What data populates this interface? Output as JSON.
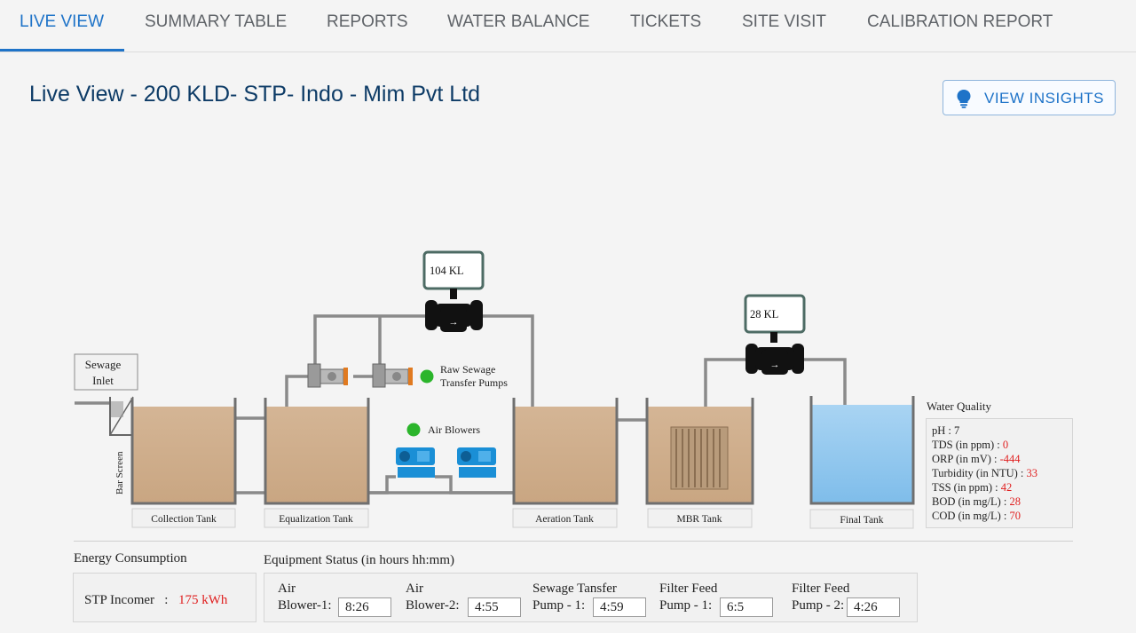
{
  "tabs": [
    {
      "label": "LIVE VIEW",
      "active": true
    },
    {
      "label": "SUMMARY TABLE"
    },
    {
      "label": "REPORTS"
    },
    {
      "label": "WATER BALANCE"
    },
    {
      "label": "TICKETS"
    },
    {
      "label": "SITE VISIT"
    },
    {
      "label": "CALIBRATION REPORT"
    }
  ],
  "page_title": "Live View - 200 KLD- STP- Indo - Mim Pvt Ltd",
  "insights_button": {
    "label": "VIEW INSIGHTS",
    "icon": "lightbulb-icon"
  },
  "diagram": {
    "sewage_inlet": [
      "Sewage",
      "Inlet"
    ],
    "bar_screen": "Bar Screen",
    "flowmeter_1": "104 KL",
    "flowmeter_2": "28 KL",
    "raw_pumps_label": [
      "Raw Sewage",
      "Transfer Pumps"
    ],
    "air_blowers_label": "Air Blowers",
    "tanks": {
      "collection": "Collection Tank",
      "equalization": "Equalization Tank",
      "aeration": "Aeration Tank",
      "mbr": "MBR Tank",
      "final": "Final Tank"
    },
    "status_color": "#2bb52b"
  },
  "water_quality": {
    "title": "Water Quality",
    "rows": [
      {
        "label": "pH :",
        "value": "7",
        "red": false
      },
      {
        "label": "TDS (in ppm) :",
        "value": "0",
        "red": true
      },
      {
        "label": "ORP (in mV) :",
        "value": "-444",
        "red": true
      },
      {
        "label": "Turbidity (in NTU) :",
        "value": "33",
        "red": true
      },
      {
        "label": "TSS (in ppm) :",
        "value": "42",
        "red": true
      },
      {
        "label": "BOD (in mg/L) :",
        "value": "28",
        "red": true
      },
      {
        "label": "COD (in mg/L) :",
        "value": "70",
        "red": true
      }
    ]
  },
  "energy": {
    "title": "Energy Consumption",
    "label": "STP Incomer",
    "separator": ":",
    "value": "175 kWh"
  },
  "equipment": {
    "title": "Equipment Status (in hours hh:mm)",
    "items": [
      {
        "line1": "Air",
        "line2": "Blower-1:",
        "value": "8:26"
      },
      {
        "line1": "Air",
        "line2": "Blower-2:",
        "value": "4:55"
      },
      {
        "line1": "Sewage Tansfer",
        "line2": "Pump - 1:",
        "value": "4:59"
      },
      {
        "line1": "Filter Feed",
        "line2": "Pump - 1:",
        "value": "6:5"
      },
      {
        "line1": "Filter Feed",
        "line2": "Pump - 2:",
        "value": "4:26"
      }
    ]
  }
}
